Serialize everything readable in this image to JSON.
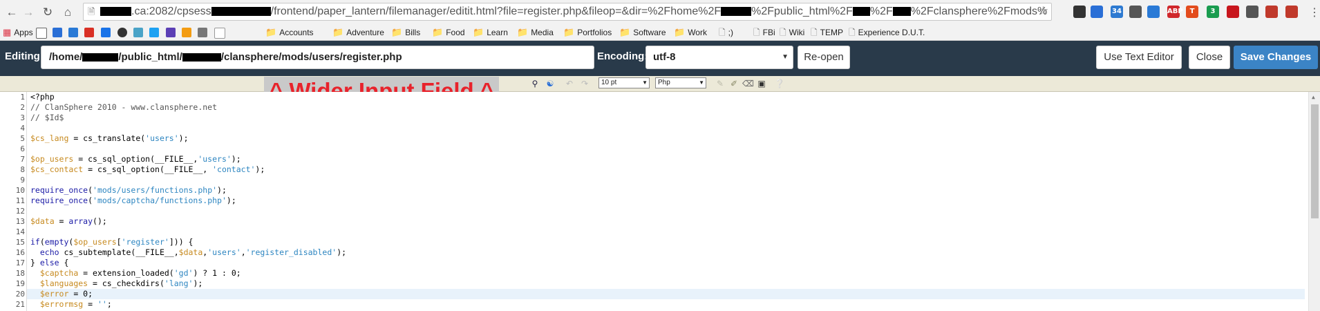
{
  "browser": {
    "url_host": ".ca:2082/cpsess",
    "url_mid": "/frontend/paper_lantern/filemanager/editit.html?file=register.php&fileop=&dir=%2Fhome%2F",
    "url_a": "%2Fpublic_html%2F",
    "url_b": "%2F",
    "url_c": "%2Fclansphere%2Fmods%",
    "extensions": [
      {
        "icon": "sync-icon",
        "label": "",
        "color": "#333333"
      },
      {
        "icon": "bird-icon",
        "label": "",
        "color": "#2a6fd6"
      },
      {
        "icon": "screen-icon",
        "label": "34",
        "color": "#2e7ad1"
      },
      {
        "icon": "puzzle-icon",
        "label": "",
        "color": "#555555"
      },
      {
        "icon": "trello-icon",
        "label": "",
        "color": "#2a7ad6"
      },
      {
        "icon": "abp-icon",
        "label": "ABP",
        "color": "#d0272b"
      },
      {
        "icon": "t-icon",
        "label": "T",
        "color": "#e34c1d"
      },
      {
        "icon": "d-icon",
        "label": "3",
        "color": "#1a9c4f"
      },
      {
        "icon": "lastpass-icon",
        "label": "",
        "color": "#c8161d"
      },
      {
        "icon": "s-icon",
        "label": "",
        "color": "#555555"
      },
      {
        "icon": "bookmark-icon",
        "label": "",
        "color": "#c0392b"
      },
      {
        "icon": "gmail-icon",
        "label": "",
        "color": "#c0392b"
      }
    ]
  },
  "bookmarks": {
    "apps": "Apps",
    "folders": [
      "Accounts",
      "Adventure",
      "Bills",
      "Food",
      "Learn",
      "Media",
      "Portfolios",
      "Software",
      "Work"
    ],
    "pages": [
      ";)",
      "FBi",
      "Wiki",
      "TEMP",
      "Experience D.U.T."
    ]
  },
  "editor": {
    "editing_label": "Editing:",
    "path_prefix": "/home/",
    "path_mid": "/public_html/",
    "path_suffix": "/clansphere/mods/users/register.php",
    "encoding_label": "Encoding:",
    "encoding_value": "utf-8",
    "reopen": "Re-open",
    "text_editor": "Use Text Editor",
    "close": "Close",
    "save": "Save Changes"
  },
  "code_toolbar": {
    "font_size": "10 pt",
    "syntax": "Php"
  },
  "annotation": "^ Wider Input Field ^",
  "code": {
    "line_numbers": [
      "1",
      "2",
      "3",
      "4",
      "5",
      "6",
      "7",
      "8",
      "9",
      "10",
      "11",
      "12",
      "13",
      "14",
      "15",
      "16",
      "17",
      "18",
      "19",
      "20",
      "21"
    ],
    "lines": [
      "<?php",
      "// ClanSphere 2010 - www.clansphere.net",
      "// $Id$",
      "",
      "$cs_lang = cs_translate('users');",
      "",
      "$op_users = cs_sql_option(__FILE__,'users');",
      "$cs_contact = cs_sql_option(__FILE__, 'contact');",
      "",
      "require_once('mods/users/functions.php');",
      "require_once('mods/captcha/functions.php');",
      "",
      "$data = array();",
      "",
      "if(empty($op_users['register'])) {",
      "  echo cs_subtemplate(__FILE__,$data,'users','register_disabled');",
      "} else {",
      "  $captcha = extension_loaded('gd') ? 1 : 0;",
      "  $languages = cs_checkdirs('lang');",
      "  $error = 0;",
      "  $errormsg = '';"
    ],
    "highlight_line": "20"
  }
}
